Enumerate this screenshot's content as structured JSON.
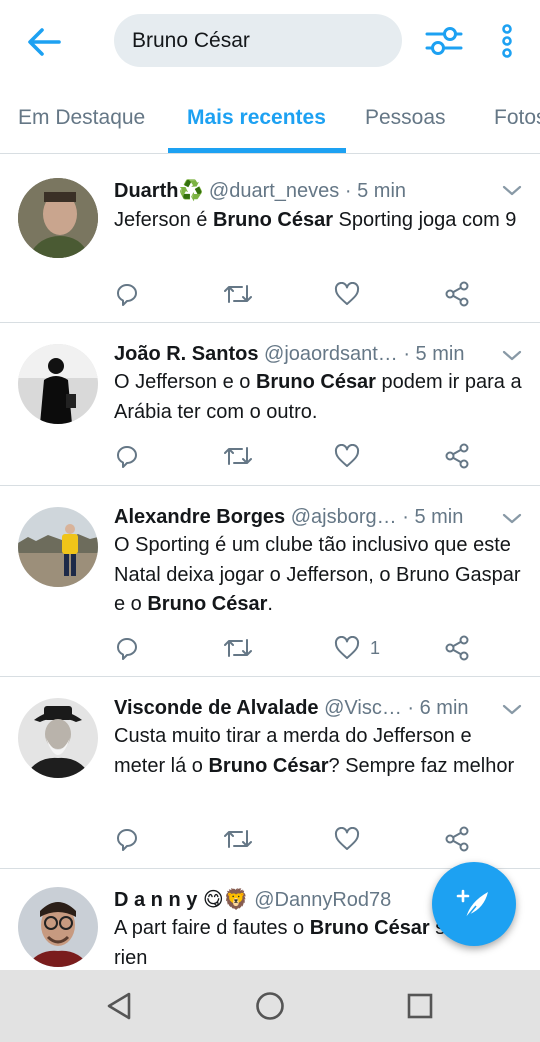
{
  "search": {
    "query": "Bruno César"
  },
  "tabs": [
    {
      "label": "Em Destaque"
    },
    {
      "label": "Mais recentes"
    },
    {
      "label": "Pessoas"
    },
    {
      "label": "Fotos"
    }
  ],
  "colors": {
    "accent": "#1da1f2",
    "text": "#14171a",
    "muted": "#657786",
    "divider": "#d8dee2",
    "nav_bg": "#e2e2e2"
  },
  "tweets": [
    {
      "name": "Duarth",
      "name_emoji": "♻️",
      "handle": "@duart_neves",
      "dot": "·",
      "time": "5 min",
      "body": [
        {
          "t": "Jeferson é "
        },
        {
          "t": "Bruno César",
          "b": true
        },
        {
          "t": " Sporting joga com 9"
        }
      ],
      "likes": ""
    },
    {
      "name": "João R. Santos",
      "name_emoji": "",
      "handle": "@joaordsant…",
      "dot": "·",
      "time": "5 min",
      "body": [
        {
          "t": "O Jefferson e o "
        },
        {
          "t": "Bruno César",
          "b": true
        },
        {
          "t": " podem ir para a Arábia ter com o outro."
        }
      ],
      "likes": ""
    },
    {
      "name": "Alexandre Borges",
      "name_emoji": "",
      "handle": "@ajsborg…",
      "dot": "·",
      "time": "5 min",
      "body": [
        {
          "t": "O Sporting é um clube tão inclusivo que este Natal deixa jogar o Jefferson, o Bruno Gaspar e o "
        },
        {
          "t": "Bruno César",
          "b": true
        },
        {
          "t": "."
        }
      ],
      "likes": "1"
    },
    {
      "name": "Visconde de Alvalade",
      "name_emoji": "",
      "handle": "@Visc…",
      "dot": "·",
      "time": "6 min",
      "body": [
        {
          "t": "Custa muito tirar a merda do Jefferson e meter lá o "
        },
        {
          "t": "Bruno César",
          "b": true
        },
        {
          "t": "? Sempre faz melhor"
        }
      ],
      "likes": ""
    },
    {
      "name": "D a n n y",
      "name_emoji": "😋🦁",
      "handle": "@DannyRod78",
      "dot": "",
      "time": "",
      "body": [
        {
          "t": "A part faire d fautes o "
        },
        {
          "t": "Bruno César",
          "b": true
        },
        {
          "t": " sert a rien"
        }
      ],
      "likes": ""
    }
  ],
  "icons": {
    "back": "arrow-left-icon",
    "filter": "sliders-icon",
    "more": "more-vertical-icon",
    "reply": "reply-icon",
    "retweet": "retweet-icon",
    "like": "heart-icon",
    "share": "share-icon",
    "compose": "compose-feather-icon",
    "nav_back": "triangle-back-icon",
    "nav_home": "circle-home-icon",
    "nav_recent": "square-recents-icon"
  }
}
